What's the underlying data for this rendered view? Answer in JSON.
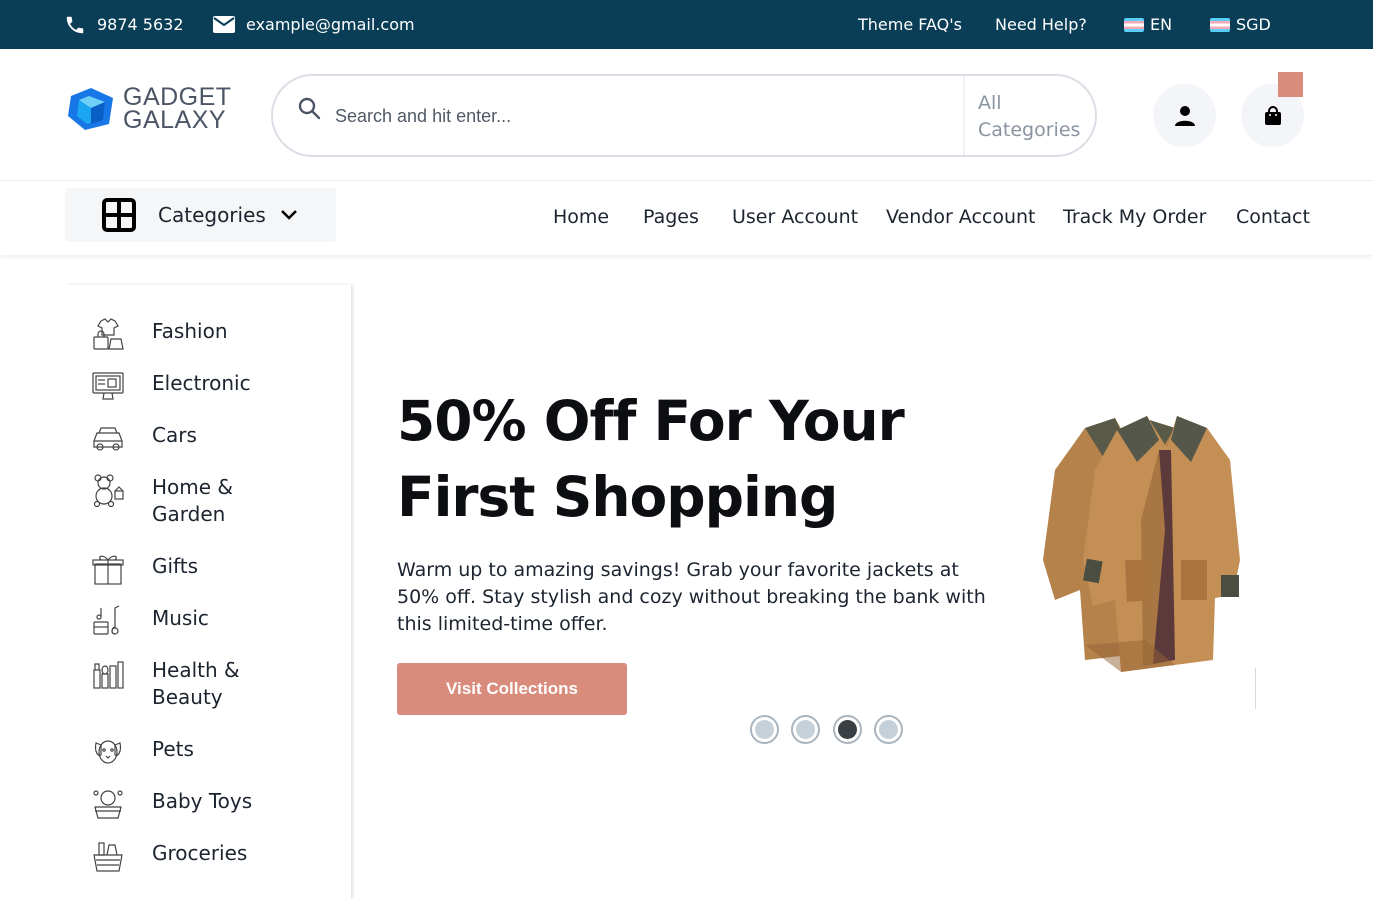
{
  "topbar": {
    "phone": "9874 5632",
    "email": "example@gmail.com",
    "faq": "Theme FAQ's",
    "help": "Need Help?",
    "language": "EN",
    "currency": "SGD"
  },
  "header": {
    "logo_line1": "GADGET",
    "logo_line2": "GALAXY",
    "search_placeholder": "Search and hit enter...",
    "search_category": "All Categories"
  },
  "nav": {
    "categories_label": "Categories",
    "links": [
      "Home",
      "Pages",
      "User Account",
      "Vendor Account",
      "Track My Order",
      "Contact"
    ]
  },
  "sidebar": {
    "items": [
      {
        "label": "Fashion",
        "icon": "fashion-icon"
      },
      {
        "label": "Electronic",
        "icon": "electronic-icon"
      },
      {
        "label": "Cars",
        "icon": "car-icon"
      },
      {
        "label": "Home & Garden",
        "icon": "teddy-bear-icon"
      },
      {
        "label": "Gifts",
        "icon": "gift-icon"
      },
      {
        "label": "Music",
        "icon": "music-icon"
      },
      {
        "label": "Health & Beauty",
        "icon": "beauty-icon"
      },
      {
        "label": "Pets",
        "icon": "pet-icon"
      },
      {
        "label": "Baby Toys",
        "icon": "baby-toy-icon"
      },
      {
        "label": "Groceries",
        "icon": "grocery-icon"
      }
    ]
  },
  "hero": {
    "title": "50% Off For Your First Shopping",
    "description": "Warm up to amazing savings! Grab your favorite jackets at 50% off. Stay stylish and cozy without breaking the bank with this limited-time offer.",
    "button": "Visit Collections",
    "slides": 4,
    "active_slide": 3
  },
  "colors": {
    "topbar": "#0a3d56",
    "accent": "#d98c7c"
  }
}
